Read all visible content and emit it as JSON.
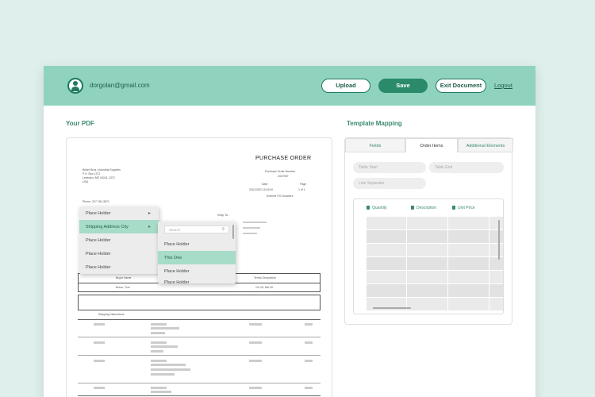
{
  "header": {
    "email": "dorgolan@gmail.com",
    "upload_label": "Upload",
    "save_label": "Save",
    "exit_label": "Exit Document",
    "logout_label": "Logout"
  },
  "pdf_panel": {
    "title": "Your PDF",
    "document": {
      "title": "PURCHASE ORDER",
      "vendor_lines": [
        "Butler Bros. Industrial Supplies",
        "P.O. Box 1372",
        "Lewiston, ME 04241-1372",
        "USA"
      ],
      "phone": "Phone:   207-784-3871",
      "po_label": "Purchase Order Number",
      "po_number": "2037057",
      "date_label": "Date",
      "page_label": "Page",
      "date_value": "3/31/2020 13:29:00",
      "page_value": "1 of 1",
      "ship_to": "Ship To :",
      "sold_to_extra": "Entered PO Numbers",
      "buyer_label": "Buyer Name",
      "buyer_value": "Bravo, Tom",
      "terms_label": "Terms Description",
      "terms_value": "1% 15, Net 30",
      "shipping_instr": "Shipping Instructions"
    },
    "context_menu": {
      "items": [
        {
          "label": "Place Holder",
          "has_arrow": true
        },
        {
          "label": "Shipping Address City",
          "has_arrow": true
        },
        {
          "label": "Place Holder",
          "has_arrow": false
        },
        {
          "label": "Place Holder",
          "has_arrow": false
        },
        {
          "label": "Place Holder",
          "has_arrow": false
        }
      ]
    },
    "sub_menu": {
      "search_placeholder": "Search",
      "items": [
        "Place Holder",
        "This One",
        "Place Holder",
        "Place Holder"
      ]
    }
  },
  "mapping_panel": {
    "title": "Template Mapping",
    "tabs": [
      "Fields",
      "Order Items",
      "Additional Elements"
    ],
    "active_tab": "Order Items",
    "inputs": {
      "table_start": "Table Start",
      "table_end": "Table End",
      "line_separator": "Line Separator"
    },
    "columns": [
      "Quantity",
      "Description",
      "Unit Price"
    ]
  },
  "colors": {
    "accent": "#8fd3bf",
    "brand_dark": "#2a8a6a",
    "background": "#dff0ec"
  }
}
